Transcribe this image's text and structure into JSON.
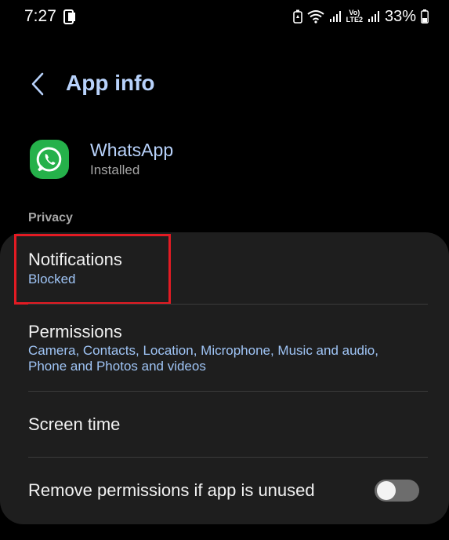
{
  "status_bar": {
    "time": "7:27",
    "battery": "33%",
    "network_label_top": "Vo)",
    "network_label_bottom": "LTE2"
  },
  "header": {
    "title": "App info",
    "back_icon": "chevron-left-icon"
  },
  "app": {
    "name": "WhatsApp",
    "status": "Installed",
    "icon": "whatsapp-logo"
  },
  "privacy": {
    "section_label": "Privacy",
    "items": [
      {
        "title": "Notifications",
        "subtitle": "Blocked"
      },
      {
        "title": "Permissions",
        "subtitle_line1": "Camera, Contacts, Location, Microphone, Music and audio,",
        "subtitle_line2": "Phone and Photos and videos"
      },
      {
        "title": "Screen time"
      },
      {
        "title": "Remove permissions if app is unused",
        "toggle": false
      }
    ]
  },
  "colors": {
    "accent": "#b8d2fb",
    "subtitle": "#9fc4f5",
    "highlight": "#e31b23",
    "whatsapp_green": "#25b14a"
  }
}
